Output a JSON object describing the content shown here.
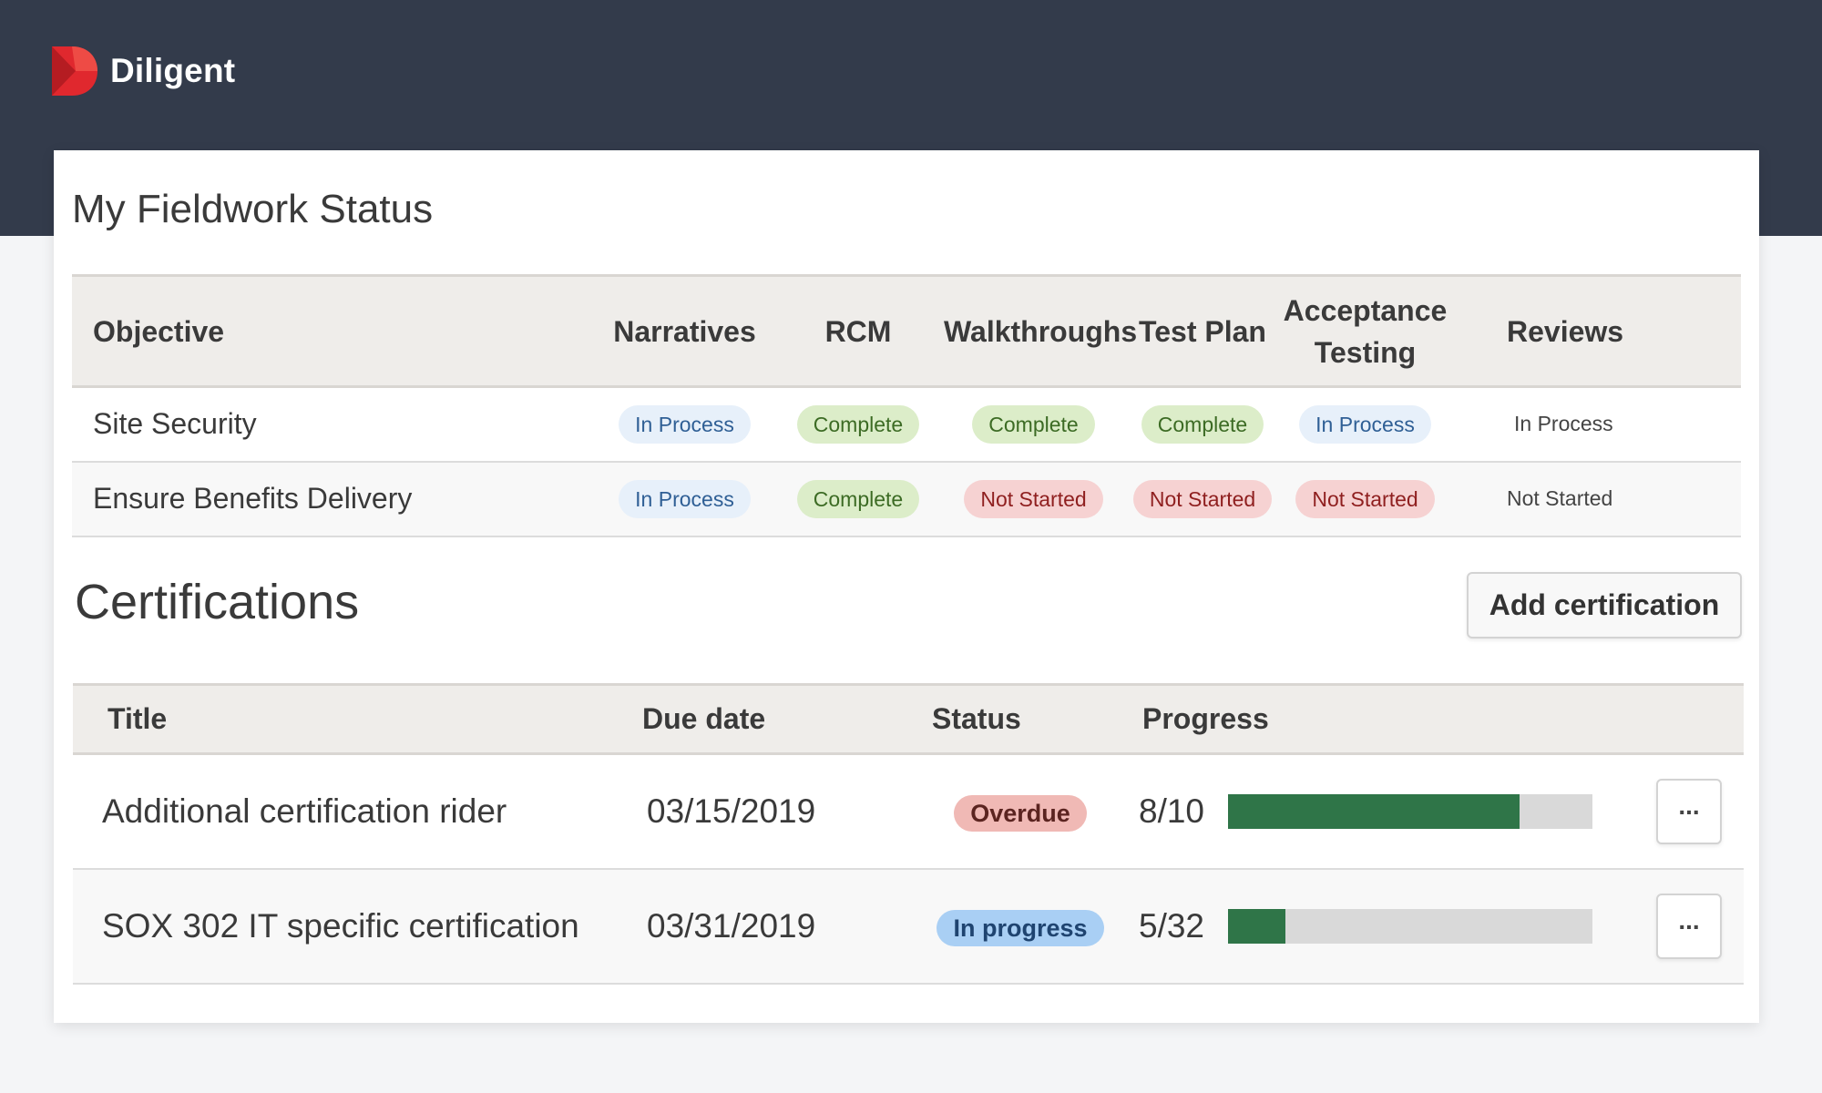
{
  "brand": {
    "name": "Diligent",
    "logo_color": "#e0282e"
  },
  "colors": {
    "header_bg": "#333b4b",
    "in_process": "#e7f0fa",
    "complete": "#dcedc9",
    "not_started": "#f6d2d2",
    "overdue": "#f0b9b5",
    "in_progress": "#a9cff4",
    "progress_fill": "#2f7548"
  },
  "fieldwork": {
    "title": "My Fieldwork Status",
    "columns": [
      "Objective",
      "Narratives",
      "RCM",
      "Walkthroughs",
      "Test Plan",
      "Acceptance Testing",
      "Reviews"
    ],
    "rows": [
      {
        "objective": "Site Security",
        "narratives": "In Process",
        "rcm": "Complete",
        "walkthroughs": "Complete",
        "test_plan": "Complete",
        "acceptance": "In Process",
        "reviews": "In Process"
      },
      {
        "objective": "Ensure Benefits Delivery",
        "narratives": "In Process",
        "rcm": "Complete",
        "walkthroughs": "Not Started",
        "test_plan": "Not Started",
        "acceptance": "Not Started",
        "reviews": "Not Started"
      }
    ]
  },
  "certifications": {
    "title": "Certifications",
    "add_label": "Add certification",
    "columns": [
      "Title",
      "Due date",
      "Status",
      "Progress"
    ],
    "rows": [
      {
        "title": "Additional certification rider",
        "due": "03/15/2019",
        "status": "Overdue",
        "progress_text": "8/10",
        "progress": 0.8,
        "more_icon": "ellipsis-icon",
        "more_label": "..."
      },
      {
        "title": "SOX 302 IT specific certification",
        "due": "03/31/2019",
        "status": "In progress",
        "progress_text": "5/32",
        "progress": 0.15625,
        "more_icon": "ellipsis-icon",
        "more_label": "..."
      }
    ]
  }
}
